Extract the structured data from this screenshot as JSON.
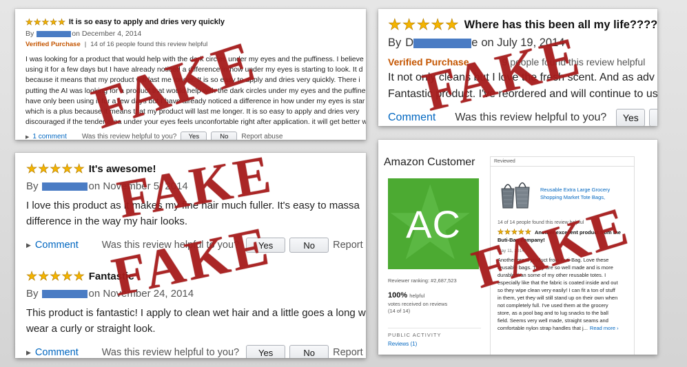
{
  "colors": {
    "star": "#f4b400",
    "verified": "#c45500",
    "link": "#0066c0",
    "stamp": "#aa1e1e",
    "avatar": "#4caa32"
  },
  "stamp_text": "FAKE",
  "card_a": {
    "stars": 5,
    "title": "It is so easy to apply and dries very quickly",
    "by_prefix": "By",
    "date_text": "on December 4, 2014",
    "verified": "Verified Purchase",
    "separator": "|",
    "helpful_count": "14 of 16 people found this review helpful",
    "body_lines": [
      "I was looking for a product that would help with the dark circles under my eyes and the puffiness. I believe",
      "using it for a few days but I have already noticed a difference in how under my eyes is starting to look. It d",
      "because it means that my product will last me longer. It is so easy to apply and dries very quickly. There i",
      "putting the AI was looking for a product that would help with the dark circles under my eyes and the puffine",
      "have only been using it for a few days but I have already noticed a difference in how under my eyes is star",
      "which is a plus because it means that my product will last me longer. It is so easy to apply and dries very",
      "discouraged if the tender area under your eyes feels unconfortable right after application. it will get better w"
    ],
    "comment_link": "1 comment",
    "helpful_question": "Was this review helpful to you?",
    "yes_label": "Yes",
    "no_label": "No",
    "report_label": "Report abuse"
  },
  "card_b": {
    "stars": 5,
    "title": "Where has this been all my life????",
    "by_prefix": "By",
    "name_start": "D",
    "name_end": "e",
    "date_text": "on July 19, 2014",
    "verified": "Verified Purchase",
    "helpful_text": "9 people found this review helpful",
    "body_lines": [
      "It not only cleans but I love the fresh scent. And as adv",
      "Fantastic product. I've reordered and will continue to us"
    ],
    "comment_link": "Comment",
    "helpful_question": "Was this review helpful to you?",
    "yes_label": "Yes"
  },
  "card_c": {
    "reviews": [
      {
        "stars": 5,
        "title": "It's awesome!",
        "by_prefix": "By",
        "date_text": "on November 5, 2014",
        "body_lines": [
          "I love this product as it makes my fine hair much fuller. It's easy to massa",
          "difference in the way my hair looks."
        ],
        "comment_link": "Comment",
        "helpful_question": "Was this review helpful to you?",
        "yes_label": "Yes",
        "no_label": "No",
        "report_label": "Report"
      },
      {
        "stars": 5,
        "title": "Fantastic",
        "by_prefix": "By",
        "date_text": "on November 24, 2014",
        "body_lines": [
          "This product is fantastic! I apply to clean wet hair and a little goes a long w",
          "wear a curly or straight look."
        ],
        "comment_link": "Comment",
        "helpful_question": "Was this review helpful to you?",
        "yes_label": "Yes",
        "no_label": "No",
        "report_label": "Report"
      }
    ]
  },
  "card_d": {
    "customer_name": "Amazon Customer",
    "avatar_initials": "AC",
    "reviewer_ranking": "Reviewer ranking: #2,687,523",
    "helpful_percent": "100%",
    "helpful_label": "helpful",
    "votes_line1": "votes received on reviews",
    "votes_line2": "(14 of 14)",
    "public_activity": "PUBLIC ACTIVITY",
    "reviews_link": "Reviews (1)",
    "panel_tab": "Reviewed",
    "product_title": "Reusable Extra Large Grocery Shopping Market Tote Bags,",
    "found_helpful": "14 of 14 people found this review helpful",
    "stars": 5,
    "review_title": "Another excellent product from the Buti-Bag company!",
    "review_date": "May 11, 2014",
    "review_lines": [
      "Another great product from Buti-Bag. Love these",
      "reusable bags. They are so well made and is more",
      "durable than some of my other reusable totes. I",
      "especially like that the fabric is coated inside and out",
      "so they wipe clean very easily! I can fit a ton of stuff",
      "in them, yet they will still stand up on their own when",
      "not completely full. I've used them at the grocery",
      "store, as a pool bag and to lug snacks to the ball",
      "field. Seems very well made, straight seams and",
      "comfortable nylon strap handles that j"
    ],
    "ellipsis": "...",
    "read_more": "Read more ›"
  }
}
